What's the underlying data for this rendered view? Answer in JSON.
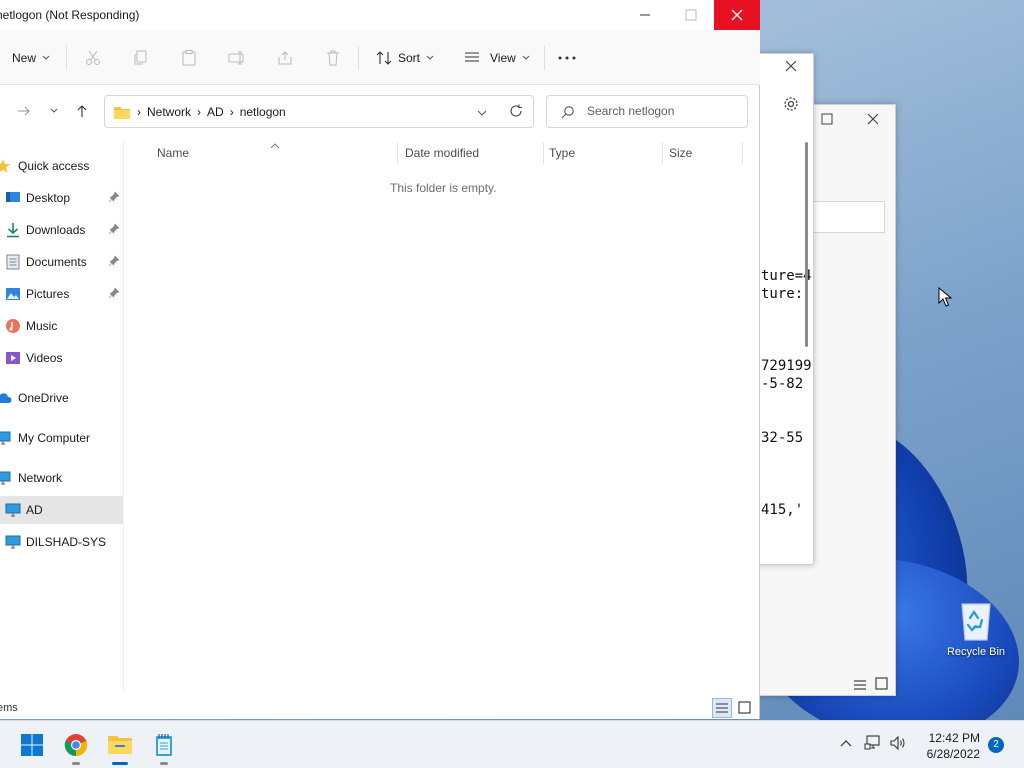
{
  "desktop": {
    "recycle_bin_label": "Recycle Bin"
  },
  "back_window": {
    "text_lines": [
      "ture=4",
      "ture:",
      "729199",
      "-5-82",
      "32-55",
      "415,'"
    ]
  },
  "explorer": {
    "title": "netlogon (Not Responding)",
    "toolbar": {
      "new_label": "New",
      "sort_label": "Sort",
      "view_label": "View"
    },
    "address": {
      "crumbs": [
        "Network",
        "AD",
        "netlogon"
      ]
    },
    "search": {
      "placeholder": "Search netlogon"
    },
    "sidebar": {
      "quick_access": "Quick access",
      "desktop": "Desktop",
      "downloads": "Downloads",
      "documents": "Documents",
      "pictures": "Pictures",
      "music": "Music",
      "videos": "Videos",
      "onedrive": "OneDrive",
      "my_computer": "My Computer",
      "network": "Network",
      "ad": "AD",
      "dilshad_sys": "DILSHAD-SYS"
    },
    "columns": {
      "name": "Name",
      "date_modified": "Date modified",
      "type": "Type",
      "size": "Size"
    },
    "empty_message": "This folder is empty.",
    "status_text": "ems"
  },
  "taskbar": {
    "time": "12:42 PM",
    "date": "6/28/2022",
    "notification_count": "2"
  },
  "colors": {
    "accent": "#0067c0",
    "close_red": "#e81123",
    "folder_yellow": "#f4c23d"
  }
}
